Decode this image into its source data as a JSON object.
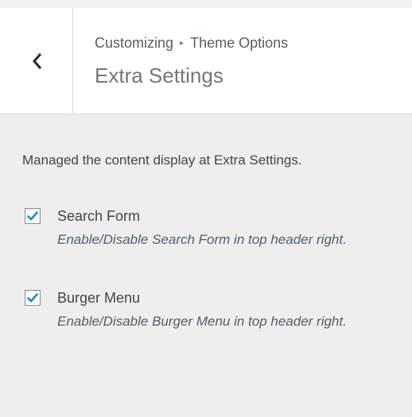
{
  "header": {
    "back_icon": "chevron-left-icon",
    "breadcrumb": {
      "root": "Customizing",
      "separator": "▸",
      "section": "Theme Options"
    },
    "title": "Extra Settings"
  },
  "content": {
    "description": "Managed the content display at Extra Settings.",
    "controls": [
      {
        "label": "Search Form",
        "checked": true,
        "description": "Enable/Disable Search Form in top header right."
      },
      {
        "label": "Burger Menu",
        "checked": true,
        "description": "Enable/Disable Burger Menu in top header right."
      }
    ]
  },
  "colors": {
    "checkmark": "#1e8cbe",
    "panel_background": "#eeeeee",
    "header_background": "#ffffff"
  }
}
